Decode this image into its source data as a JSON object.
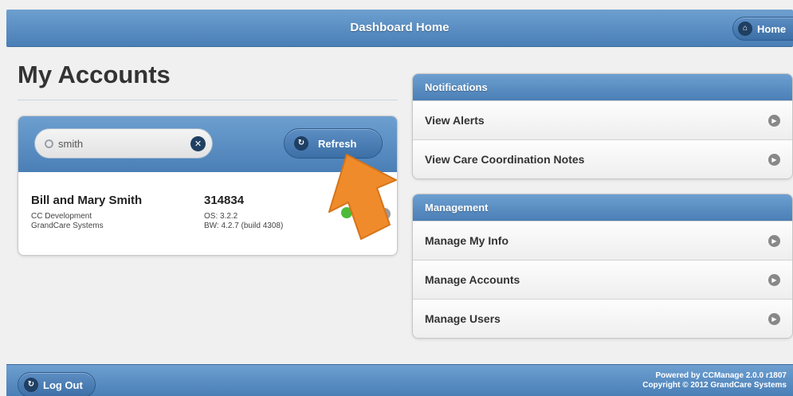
{
  "header": {
    "title": "Dashboard Home",
    "home_label": "Home"
  },
  "page": {
    "title": "My Accounts"
  },
  "search": {
    "value": "smith",
    "refresh_label": "Refresh"
  },
  "account": {
    "name": "Bill and Mary Smith",
    "line1": "CC Development",
    "line2": "GrandCare Systems",
    "id": "314834",
    "os": "OS: 3.2.2",
    "bw": "BW: 4.2.7 (build 4308)",
    "status_color": "#4cbb3a"
  },
  "notifications": {
    "heading": "Notifications",
    "items": [
      "View Alerts",
      "View Care Coordination Notes"
    ]
  },
  "management": {
    "heading": "Management",
    "items": [
      "Manage My Info",
      "Manage Accounts",
      "Manage Users"
    ]
  },
  "footer": {
    "logout_label": "Log Out",
    "powered": "Powered by CCManage 2.0.0 r1807",
    "copyright": "Copyright © 2012 GrandCare Systems"
  },
  "colors": {
    "bar_blue": "#4a7fb6",
    "pointer_orange": "#f08b2c"
  },
  "icons": [
    "home-icon",
    "search-icon",
    "clear-icon",
    "refresh-icon",
    "chevron-right-icon",
    "logout-icon",
    "pointer-arrow-icon"
  ]
}
